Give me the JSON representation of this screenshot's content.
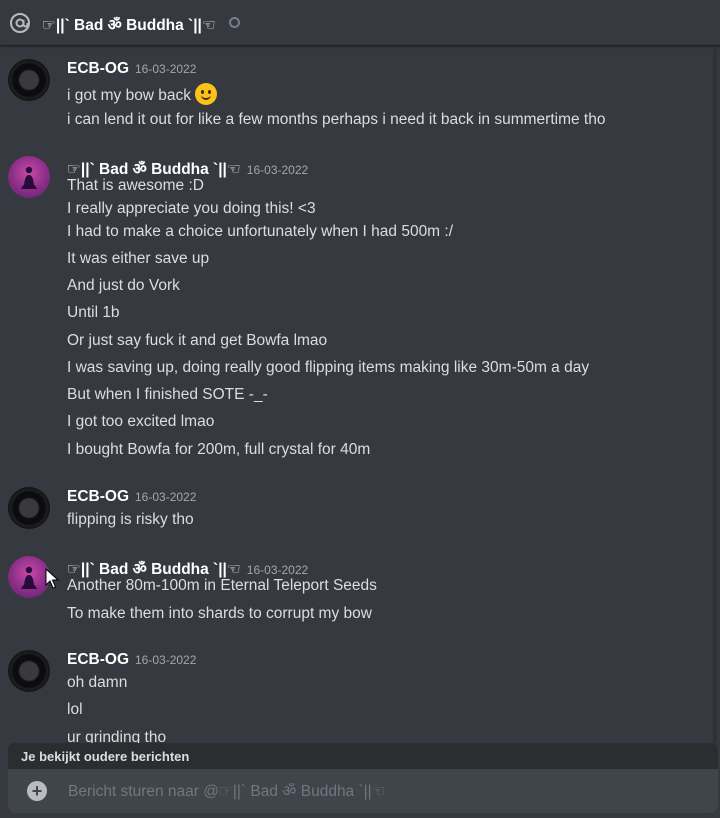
{
  "header": {
    "title": "☞||` Bad ॐ Buddha `||☜",
    "icon": "at-icon",
    "status": "offline-status-icon"
  },
  "groups": [
    {
      "author": "ECB-OG",
      "timestamp": "16-03-2022",
      "avatar": "dark",
      "lines": [
        "i got my bow back",
        "i can lend it out for like a few months perhaps i need it back in summertime tho"
      ],
      "emoji": "slightly-smiling-face-icon"
    },
    {
      "author": "☞||` Bad ॐ Buddha `||☜",
      "timestamp": "16-03-2022",
      "avatar": "buddha",
      "lines": [
        "That is awesome :D",
        "I really appreciate you doing this! <3",
        "I had to make a choice unfortunately when I had 500m :/",
        "It was either save up",
        "And just do Vork",
        "Until 1b",
        "Or just say fuck it and get Bowfa lmao",
        "I was saving up, doing really good flipping items making like 30m-50m a day",
        "But when I finished SOTE -_-",
        "I got too excited lmao",
        "I bought Bowfa for 200m, full crystal for 40m"
      ]
    },
    {
      "author": "ECB-OG",
      "timestamp": "16-03-2022",
      "avatar": "dark",
      "lines": [
        "flipping is risky tho"
      ]
    },
    {
      "author": "☞||` Bad ॐ Buddha `||☜",
      "timestamp": "16-03-2022",
      "avatar": "buddha",
      "lines": [
        "Another 80m-100m in Eternal Teleport Seeds",
        "To make them into shards to corrupt my bow"
      ]
    },
    {
      "author": "ECB-OG",
      "timestamp": "16-03-2022",
      "avatar": "dark",
      "lines": [
        "oh damn",
        "lol",
        "ur grinding tho"
      ]
    }
  ],
  "notice": "Je bekijkt oudere berichten",
  "composer": {
    "placeholder": "Bericht sturen naar @☞||` Bad ॐ Buddha `||☜",
    "add_icon": "plus-circle-icon"
  },
  "colors": {
    "background": "#36393f",
    "composer": "#40444b",
    "username": "#ffffff",
    "text": "#dcddde",
    "timestamp": "#a3a6aa"
  }
}
